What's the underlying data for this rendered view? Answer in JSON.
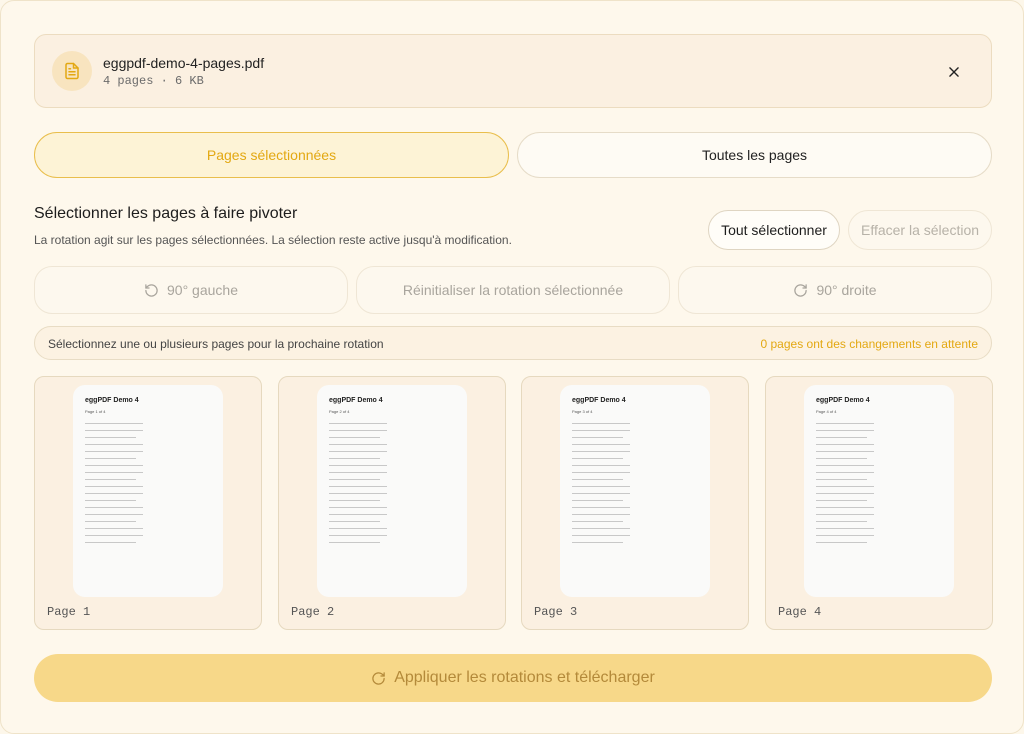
{
  "file": {
    "name": "eggpdf-demo-4-pages.pdf",
    "meta": "4 pages · 6 KB",
    "icon": "file-text-icon",
    "close_icon": "close-icon"
  },
  "mode": {
    "selected_label": "Pages sélectionnées",
    "all_label": "Toutes les pages",
    "active": "selected"
  },
  "section": {
    "title": "Sélectionner les pages à faire pivoter",
    "description": "La rotation agit sur les pages sélectionnées. La sélection reste active jusqu'à modification.",
    "select_all_label": "Tout sélectionner",
    "clear_selection_label": "Effacer la sélection"
  },
  "rotation": {
    "left_label": "90° gauche",
    "reset_label": "Réinitialiser la rotation sélectionnée",
    "right_label": "90° droite"
  },
  "status": {
    "hint": "Sélectionnez une ou plusieurs pages pour la prochaine rotation",
    "pending": "0 pages ont des changements en attente"
  },
  "pages": [
    {
      "label": "Page 1",
      "thumb_title": "eggPDF Demo 4",
      "thumb_sub": "Page 1 of 4"
    },
    {
      "label": "Page 2",
      "thumb_title": "eggPDF Demo 4",
      "thumb_sub": "Page 2 of 4"
    },
    {
      "label": "Page 3",
      "thumb_title": "eggPDF Demo 4",
      "thumb_sub": "Page 3 of 4"
    },
    {
      "label": "Page 4",
      "thumb_title": "eggPDF Demo 4",
      "thumb_sub": "Page 4 of 4"
    }
  ],
  "apply": {
    "label": "Appliquer les rotations et télécharger",
    "icon": "rotate-cw-icon"
  },
  "colors": {
    "accent": "#e3a812",
    "apply_bg": "#f7d889",
    "background": "#fef8ec"
  }
}
